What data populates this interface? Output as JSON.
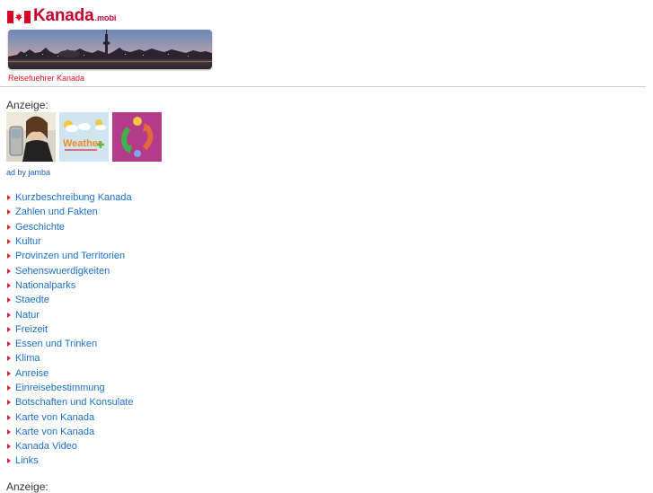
{
  "header": {
    "logo_text": "Kanada",
    "logo_suffix": ".mobi",
    "tagline": "Reisefuehrer Kanada"
  },
  "ads": {
    "label": "Anzeige:",
    "weather_text": "Weather",
    "by_text": "ad by jamba",
    "label_bottom": "Anzeige:"
  },
  "nav": {
    "items": [
      {
        "label": "Kurzbeschreibung Kanada"
      },
      {
        "label": "Zahlen und Fakten"
      },
      {
        "label": "Geschichte"
      },
      {
        "label": "Kultur"
      },
      {
        "label": "Provinzen und Territorien"
      },
      {
        "label": "Sehenswuerdigkeiten"
      },
      {
        "label": "Nationalparks"
      },
      {
        "label": "Staedte"
      },
      {
        "label": "Natur"
      },
      {
        "label": "Freizeit"
      },
      {
        "label": "Essen und Trinken"
      },
      {
        "label": "Klima"
      },
      {
        "label": "Anreise"
      },
      {
        "label": "Einreisebestimmung"
      },
      {
        "label": "Botschaften und Konsulate"
      },
      {
        "label": "Karte von Kanada"
      },
      {
        "label": "Karte von Kanada"
      },
      {
        "label": "Kanada Video"
      },
      {
        "label": "Links"
      }
    ]
  },
  "colors": {
    "brand_red": "#c4002c",
    "link_blue": "#1a6fc9",
    "bullet_red": "#e0212e"
  }
}
